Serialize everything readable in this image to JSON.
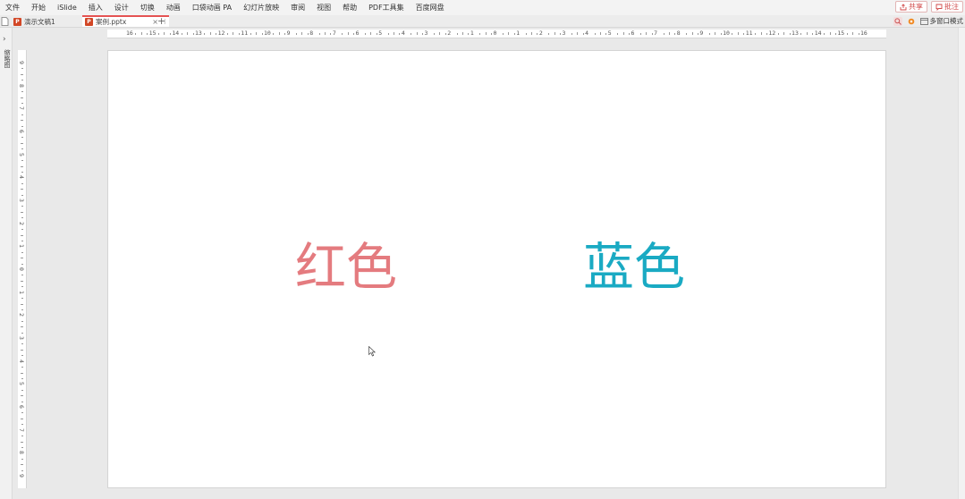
{
  "menu": {
    "items": [
      "文件",
      "开始",
      "iSlide",
      "插入",
      "设计",
      "切换",
      "动画",
      "口袋动画 PA",
      "幻灯片放映",
      "审阅",
      "视图",
      "帮助",
      "PDF工具集",
      "百度网盘"
    ],
    "share_label": "共享",
    "comment_label": "批注"
  },
  "tabs": [
    {
      "label": "演示文稿1",
      "active": false
    },
    {
      "label": "案例.pptx",
      "active": true
    }
  ],
  "tabbar": {
    "close_glyph": "×",
    "new_tab_glyph": "+",
    "multiwindow_label": "多窗口模式"
  },
  "leftnav": {
    "label": "缩略图"
  },
  "ruler": {
    "h_labels": [
      "16",
      "15",
      "14",
      "13",
      "12",
      "11",
      "10",
      "9",
      "8",
      "7",
      "6",
      "5",
      "4",
      "3",
      "2",
      "1",
      "0",
      "1",
      "2",
      "3",
      "4",
      "5",
      "6",
      "7",
      "8",
      "9",
      "10",
      "11",
      "12",
      "13",
      "14",
      "15",
      "16"
    ],
    "v_labels": [
      "9",
      "8",
      "7",
      "6",
      "5",
      "4",
      "3",
      "2",
      "1",
      "0",
      "1",
      "2",
      "3",
      "4",
      "5",
      "6",
      "7",
      "8",
      "9"
    ]
  },
  "slide": {
    "red_text": "红色",
    "blue_text": "蓝色",
    "red_color": "#e47b7f",
    "blue_color": "#1aaac3"
  },
  "colors": {
    "accent": "#e55353"
  }
}
